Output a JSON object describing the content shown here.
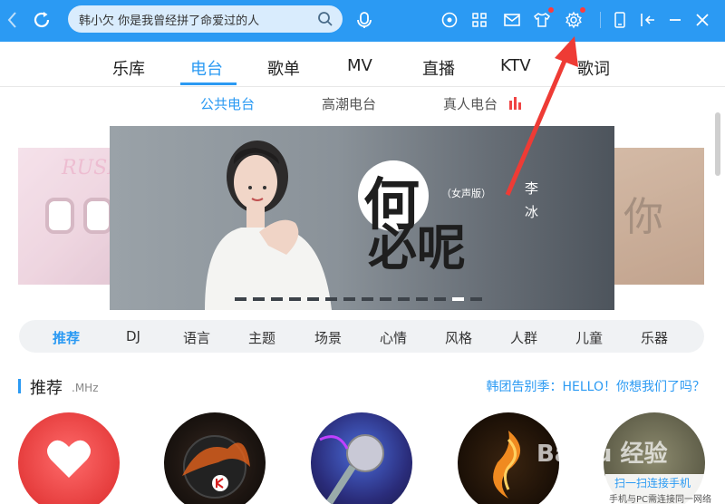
{
  "search": {
    "value": "韩小欠 你是我曾经拼了命爱过的人"
  },
  "nav": {
    "items": [
      "乐库",
      "电台",
      "歌单",
      "MV",
      "直播",
      "KTV",
      "歌词"
    ],
    "active": "电台"
  },
  "sub_tabs": [
    "公共电台",
    "高潮电台",
    "真人电台"
  ],
  "banner": {
    "title_main_1": "何",
    "title_main_2": "必呢",
    "title_tag": "（女声版）",
    "artist": "李冰",
    "left_slide_text": "RUSH",
    "right_slide_text": "你",
    "page_count": 14,
    "active_page": 12
  },
  "categories": [
    "推荐",
    "DJ",
    "语言",
    "主题",
    "场景",
    "心情",
    "风格",
    "人群",
    "儿童",
    "乐器"
  ],
  "recommend": {
    "title": "推荐",
    "subtitle": ".MHz",
    "link": "韩团告别季：HELLO！你想我们了吗？"
  },
  "watermark": "Baidu 经验",
  "qr": {
    "title": "扫一扫连接手机",
    "sub": "手机与PC需连接同一网络"
  },
  "colors": {
    "brand": "#2b9af3",
    "badge": "#ff3b3b"
  }
}
